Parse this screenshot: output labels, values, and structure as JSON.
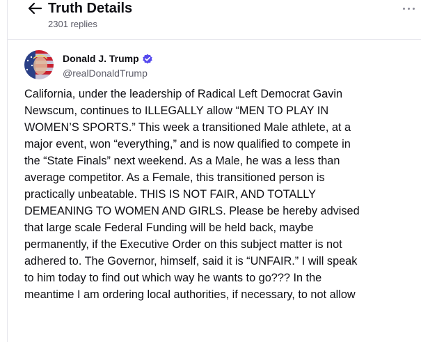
{
  "header": {
    "title": "Truth Details",
    "reply_count": "2301 replies"
  },
  "post": {
    "author_name": "Donald J. Trump",
    "author_handle": "@realDonaldTrump",
    "verified": true,
    "text_lines": [
      "California, under the leadership of Radical Left Democrat Gavin",
      "Newscum, continues to ILLEGALLY allow “MEN TO PLAY IN",
      "WOMEN’S SPORTS.” This week a transitioned Male athlete, at a",
      "major event, won “everything,” and is now qualified to compete in",
      "the “State Finals” next weekend. As a Male, he was a less than",
      "average competitor. As a Female, this transitioned person is",
      "practically unbeatable. THIS IS NOT FAIR, AND TOTALLY",
      "DEMEANING TO WOMEN AND GIRLS. Please be hereby advised",
      "that large scale Federal Funding will be held back, maybe",
      "permanently, if the Executive Order on this subject matter is not",
      "adhered to. The Governor, himself, said it is “UNFAIR.” I will speak",
      "to him today to find out which way he wants to go??? In the",
      "meantime I am ordering local authorities, if necessary, to not allow"
    ]
  },
  "icons": {
    "back": "arrow-left-icon",
    "more": "more-horizontal-icon",
    "verified": "verified-badge-icon"
  },
  "colors": {
    "accent": "#5448ee",
    "text_primary": "#0f0f14",
    "text_secondary": "#5a5a66",
    "border": "#e6e6ec"
  }
}
